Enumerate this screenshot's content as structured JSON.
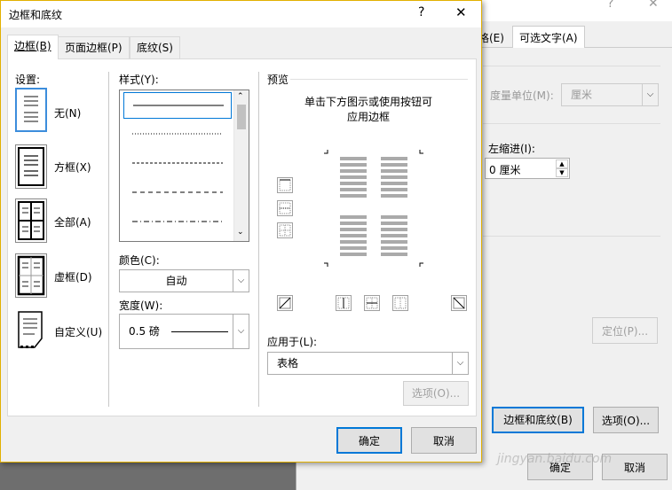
{
  "background_dialog": {
    "help_label": "?",
    "tabs": [
      "格(E)",
      "可选文字(A)"
    ],
    "measure_unit_label": "度量单位(M):",
    "measure_unit_value": "厘米",
    "left_indent_label": "左缩进(I):",
    "left_indent_value": "0 厘米",
    "position_button": "定位(P)...",
    "borders_button": "边框和底纹(B)",
    "options_button": "选项(O)...",
    "ok_button": "确定",
    "cancel_button": "取消"
  },
  "dialog": {
    "title": "边框和底纹",
    "help_label": "?",
    "close_label": "✕",
    "tabs": [
      "边框(B)",
      "页面边框(P)",
      "底纹(S)"
    ],
    "settings_label": "设置:",
    "settings": [
      "无(N)",
      "方框(X)",
      "全部(A)",
      "虚框(D)",
      "自定义(U)"
    ],
    "style_label": "样式(Y):",
    "color_label": "颜色(C):",
    "color_value": "自动",
    "width_label": "宽度(W):",
    "width_value": "0.5 磅",
    "preview_label": "预览",
    "preview_hint_line1": "单击下方图示或使用按钮可",
    "preview_hint_line2": "应用边框",
    "apply_to_label": "应用于(L):",
    "apply_to_value": "表格",
    "options_button": "选项(O)...",
    "ok_button": "确定",
    "cancel_button": "取消"
  },
  "watermark": "jingyan.baidu.com",
  "colors": {
    "accent": "#0078d7",
    "title_border": "#e2b000"
  }
}
